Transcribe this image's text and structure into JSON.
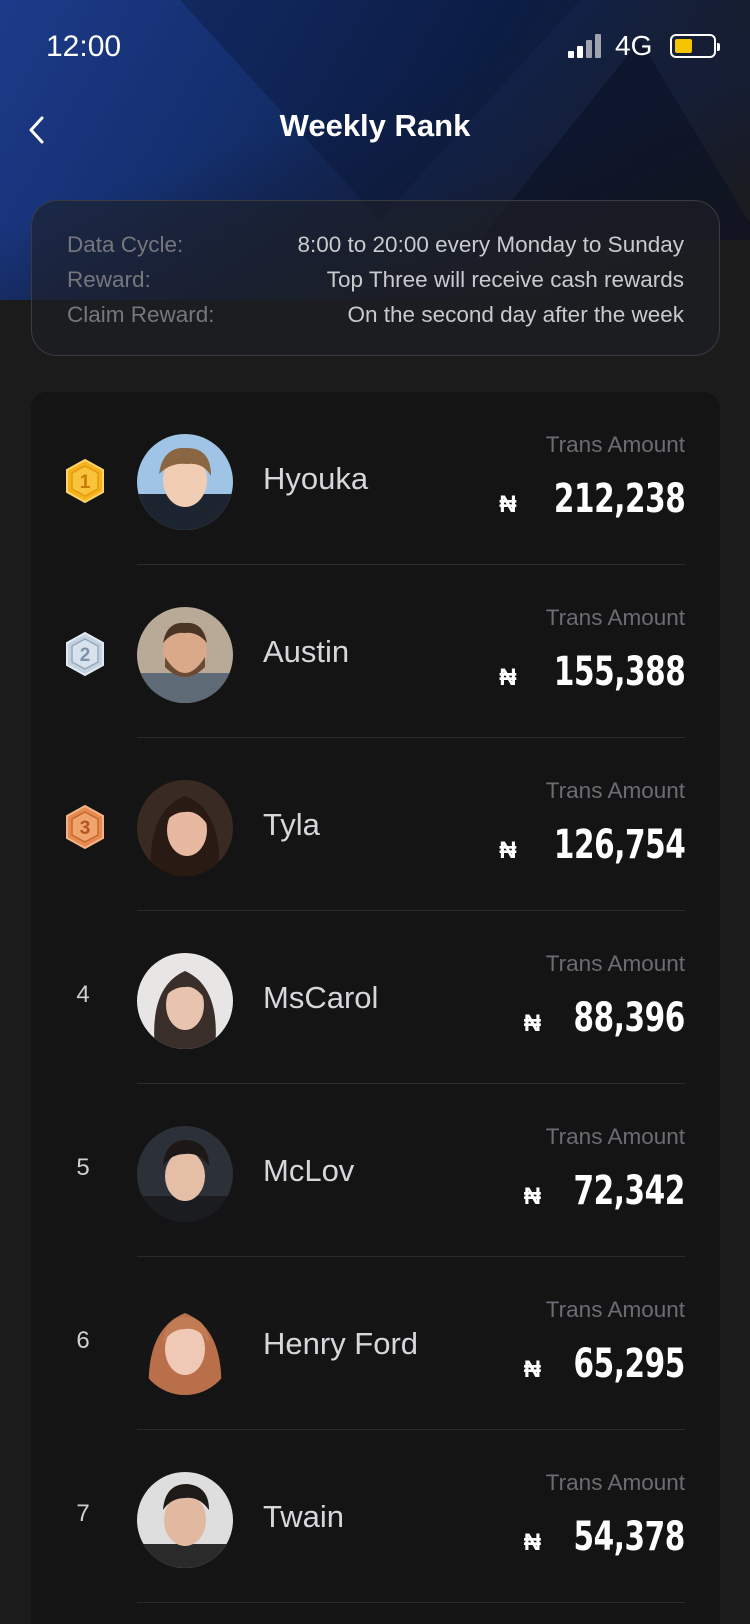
{
  "status_bar": {
    "time": "12:00",
    "network": "4G",
    "battery_color": "#f5c400",
    "battery_level": 0.45
  },
  "nav": {
    "back_icon": "chevron-left-icon",
    "title": "Weekly Rank"
  },
  "info": {
    "rows": [
      {
        "label": "Data Cycle:",
        "value": "8:00 to 20:00 every Monday to Sunday"
      },
      {
        "label": "Reward:",
        "value": "Top Three will receive cash rewards"
      },
      {
        "label": "Claim Reward:",
        "value": "On the second day after the week"
      }
    ]
  },
  "ranking": {
    "amount_label": "Trans Amount",
    "currency": "₦",
    "rows": [
      {
        "rank": "1",
        "badge": "gold-medal-icon",
        "name": "Hyouka",
        "amount": "212,238"
      },
      {
        "rank": "2",
        "badge": "silver-medal-icon",
        "name": "Austin",
        "amount": "155,388"
      },
      {
        "rank": "3",
        "badge": "bronze-medal-icon",
        "name": "Tyla",
        "amount": "126,754"
      },
      {
        "rank": "4",
        "name": "MsCarol",
        "amount": "88,396"
      },
      {
        "rank": "5",
        "name": "McLov",
        "amount": "72,342"
      },
      {
        "rank": "6",
        "name": "Henry Ford",
        "amount": "65,295"
      },
      {
        "rank": "7",
        "name": "Twain",
        "amount": "54,378"
      }
    ]
  },
  "colors": {
    "gold": "#f6b21b",
    "silver": "#aebfd2",
    "bronze": "#e58b52",
    "background": "#1b1b1c",
    "card": "#141415"
  }
}
